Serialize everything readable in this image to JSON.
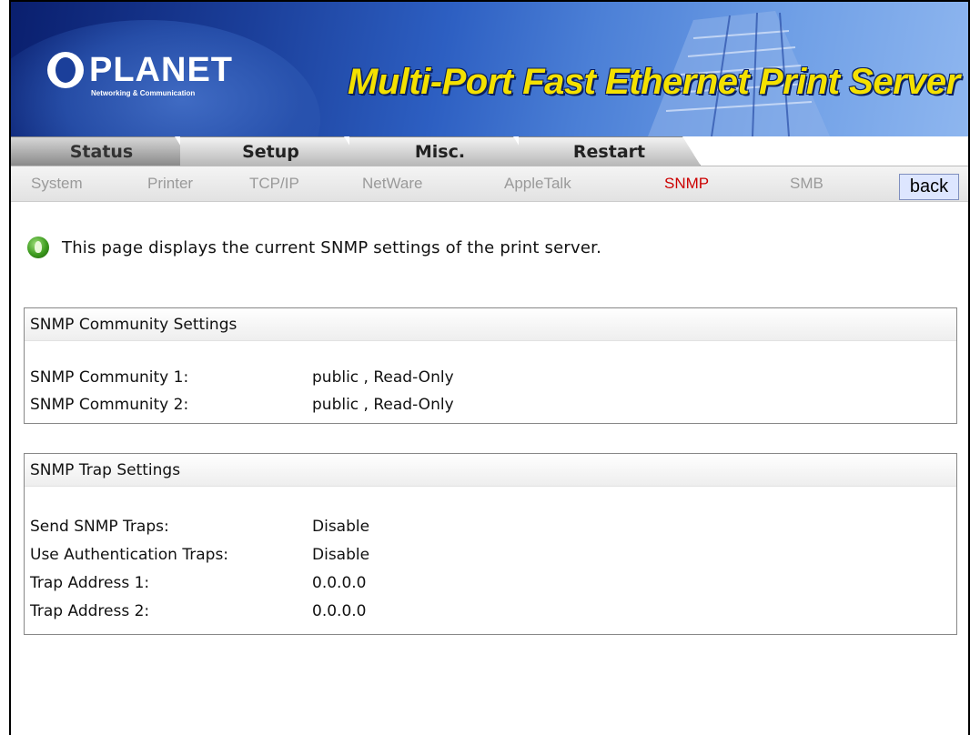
{
  "banner": {
    "brand": "PLANET",
    "brand_tagline": "Networking & Communication",
    "product_title": "Multi-Port Fast Ethernet Print Server"
  },
  "main_tabs": [
    {
      "label": "Status",
      "active": true
    },
    {
      "label": "Setup",
      "active": false
    },
    {
      "label": "Misc.",
      "active": false
    },
    {
      "label": "Restart",
      "active": false
    }
  ],
  "sub_nav": {
    "items": [
      {
        "label": "System",
        "active": false
      },
      {
        "label": "Printer",
        "active": false
      },
      {
        "label": "TCP/IP",
        "active": false
      },
      {
        "label": "NetWare",
        "active": false
      },
      {
        "label": "AppleTalk",
        "active": false
      },
      {
        "label": "SNMP",
        "active": true
      },
      {
        "label": "SMB",
        "active": false
      }
    ],
    "back_label": "back"
  },
  "description": "This page displays the current SNMP settings of the print server.",
  "community": {
    "title": "SNMP Community Settings",
    "rows": [
      {
        "label": "SNMP Community 1:",
        "value": "public , Read-Only"
      },
      {
        "label": "SNMP Community 2:",
        "value": "public , Read-Only"
      }
    ]
  },
  "trap": {
    "title": "SNMP Trap Settings",
    "rows": [
      {
        "label": "Send SNMP Traps:",
        "value": "Disable"
      },
      {
        "label": "Use Authentication Traps:",
        "value": "Disable"
      },
      {
        "label": "Trap Address 1:",
        "value": "0.0.0.0"
      },
      {
        "label": "Trap Address 2:",
        "value": "0.0.0.0"
      }
    ]
  },
  "colors": {
    "active_sub": "#cc0000",
    "title_yellow": "#f4e100",
    "back_bg": "#dde6ff"
  }
}
